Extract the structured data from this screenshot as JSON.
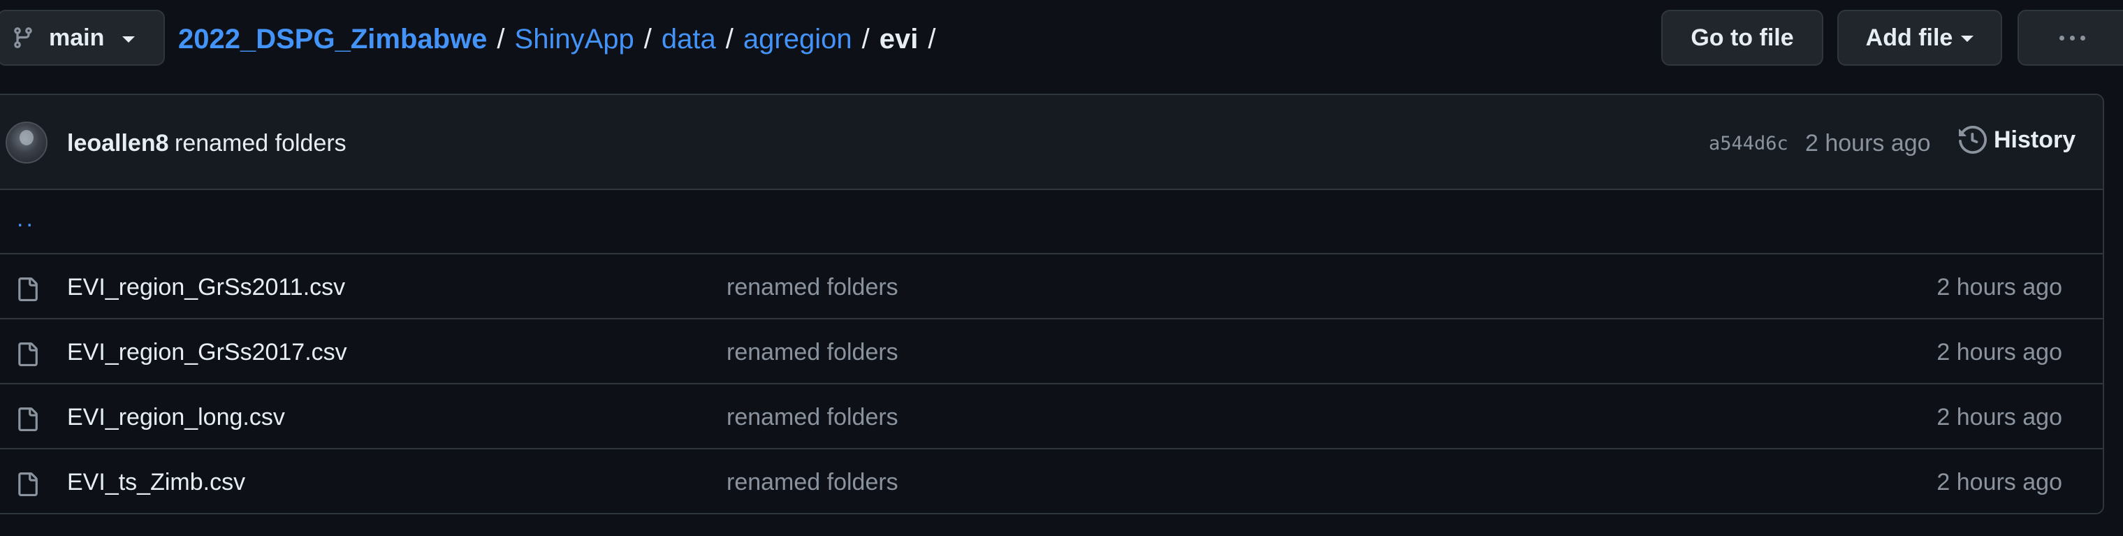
{
  "branch": {
    "name": "main"
  },
  "breadcrumb": {
    "repo": "2022_DSPG_Zimbabwe",
    "segments": [
      "ShinyApp",
      "data",
      "agregion"
    ],
    "current": "evi",
    "separator": "/"
  },
  "actions": {
    "go_to_file": "Go to file",
    "add_file": "Add file"
  },
  "commit": {
    "author": "leoallen8",
    "message": "renamed folders",
    "sha": "a544d6c",
    "time": "2 hours ago",
    "history_label": "History"
  },
  "parent_link": "..",
  "files": [
    {
      "name": "EVI_region_GrSs2011.csv",
      "commit": "renamed folders",
      "time": "2 hours ago"
    },
    {
      "name": "EVI_region_GrSs2017.csv",
      "commit": "renamed folders",
      "time": "2 hours ago"
    },
    {
      "name": "EVI_region_long.csv",
      "commit": "renamed folders",
      "time": "2 hours ago"
    },
    {
      "name": "EVI_ts_Zimb.csv",
      "commit": "renamed folders",
      "time": "2 hours ago"
    }
  ],
  "colors": {
    "background": "#0d1117",
    "link": "#4493f8",
    "border": "#30363d",
    "muted": "#8b949e"
  },
  "icons": {
    "branch": "git-branch-icon",
    "file": "file-icon",
    "history": "history-clock-icon",
    "more": "kebab-horizontal-icon"
  }
}
